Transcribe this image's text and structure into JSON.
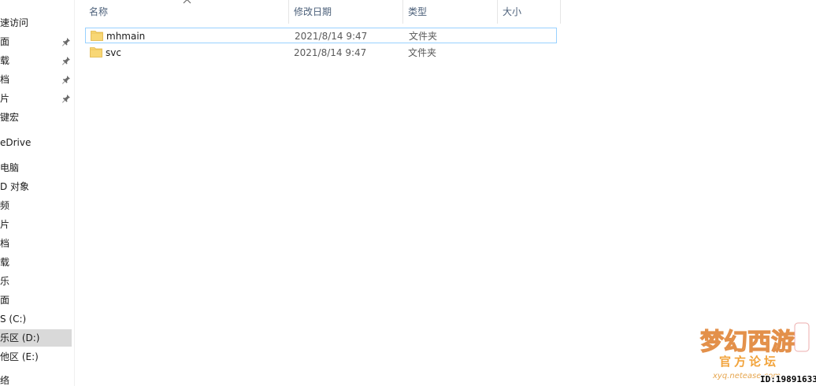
{
  "nav": {
    "items": [
      {
        "label": "速访问",
        "pinned": false
      },
      {
        "label": "面",
        "pinned": true
      },
      {
        "label": "载",
        "pinned": true
      },
      {
        "label": "档",
        "pinned": true
      },
      {
        "label": "片",
        "pinned": true
      },
      {
        "label": "键宏",
        "pinned": false
      },
      {
        "label": "eDrive",
        "pinned": false
      },
      {
        "label": "电脑",
        "pinned": false
      },
      {
        "label": "D 对象",
        "pinned": false
      },
      {
        "label": "频",
        "pinned": false
      },
      {
        "label": "片",
        "pinned": false
      },
      {
        "label": "档",
        "pinned": false
      },
      {
        "label": "载",
        "pinned": false
      },
      {
        "label": "乐",
        "pinned": false
      },
      {
        "label": "面",
        "pinned": false
      },
      {
        "label": "S (C:)",
        "pinned": false
      },
      {
        "label": "乐区 (D:)",
        "pinned": false,
        "selected": true
      },
      {
        "label": "他区 (E:)",
        "pinned": false
      },
      {
        "label": "络",
        "pinned": false
      }
    ]
  },
  "columns": {
    "name": "名称",
    "date": "修改日期",
    "type": "类型",
    "size": "大小"
  },
  "files": [
    {
      "name": "mhmain",
      "date": "2021/8/14 9:47",
      "type": "文件夹",
      "icon": "folder-icon"
    },
    {
      "name": "svc",
      "date": "2021/8/14 9:47",
      "type": "文件夹",
      "icon": "folder-icon"
    }
  ],
  "watermark": {
    "logo_text": "梦幻西游",
    "subtitle": "官方论坛",
    "url": "xyq.netease.com",
    "id_text": "ID:19891633"
  },
  "colors": {
    "header_text": "#4c607a",
    "selection": "#d9d9d9",
    "focus_border": "#99d1ff",
    "folder": "#f8d775"
  }
}
